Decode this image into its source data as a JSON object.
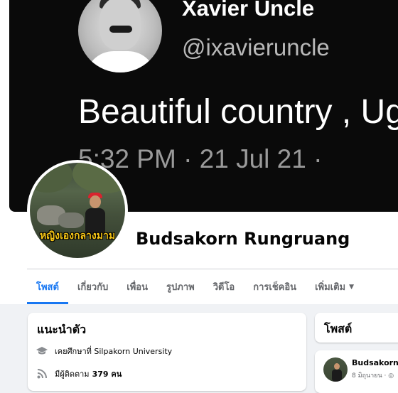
{
  "cover": {
    "tweet_name": "Xavier Uncle",
    "tweet_handle": "@ixavieruncle",
    "tweet_text": "Beautiful country , Ug",
    "tweet_time": "5:32 PM · 21 Jul 21 ·"
  },
  "profile": {
    "name": "Budsakorn Rungruang",
    "photo_caption": "หญิงเองกลางมาม"
  },
  "tabs": [
    {
      "label": "โพสต์",
      "active": true
    },
    {
      "label": "เกี่ยวกับ"
    },
    {
      "label": "เพื่อน"
    },
    {
      "label": "รูปภาพ"
    },
    {
      "label": "วิดีโอ"
    },
    {
      "label": "การเช็คอิน"
    },
    {
      "label": "เพิ่มเติม"
    }
  ],
  "intro": {
    "title": "แนะนำตัว",
    "studied": "เคยศึกษาที่ Silpakorn University",
    "followers_prefix": "มีผู้ติดตาม",
    "followers_count": "379 คน"
  },
  "posts": {
    "title": "โพสต์",
    "author": "Budsakorn R",
    "date": "8 มิถุนายน ·"
  },
  "colors": {
    "accent": "#1877f2",
    "page_bg": "#f0f2f5",
    "cover_bg": "#0a0a0a"
  }
}
